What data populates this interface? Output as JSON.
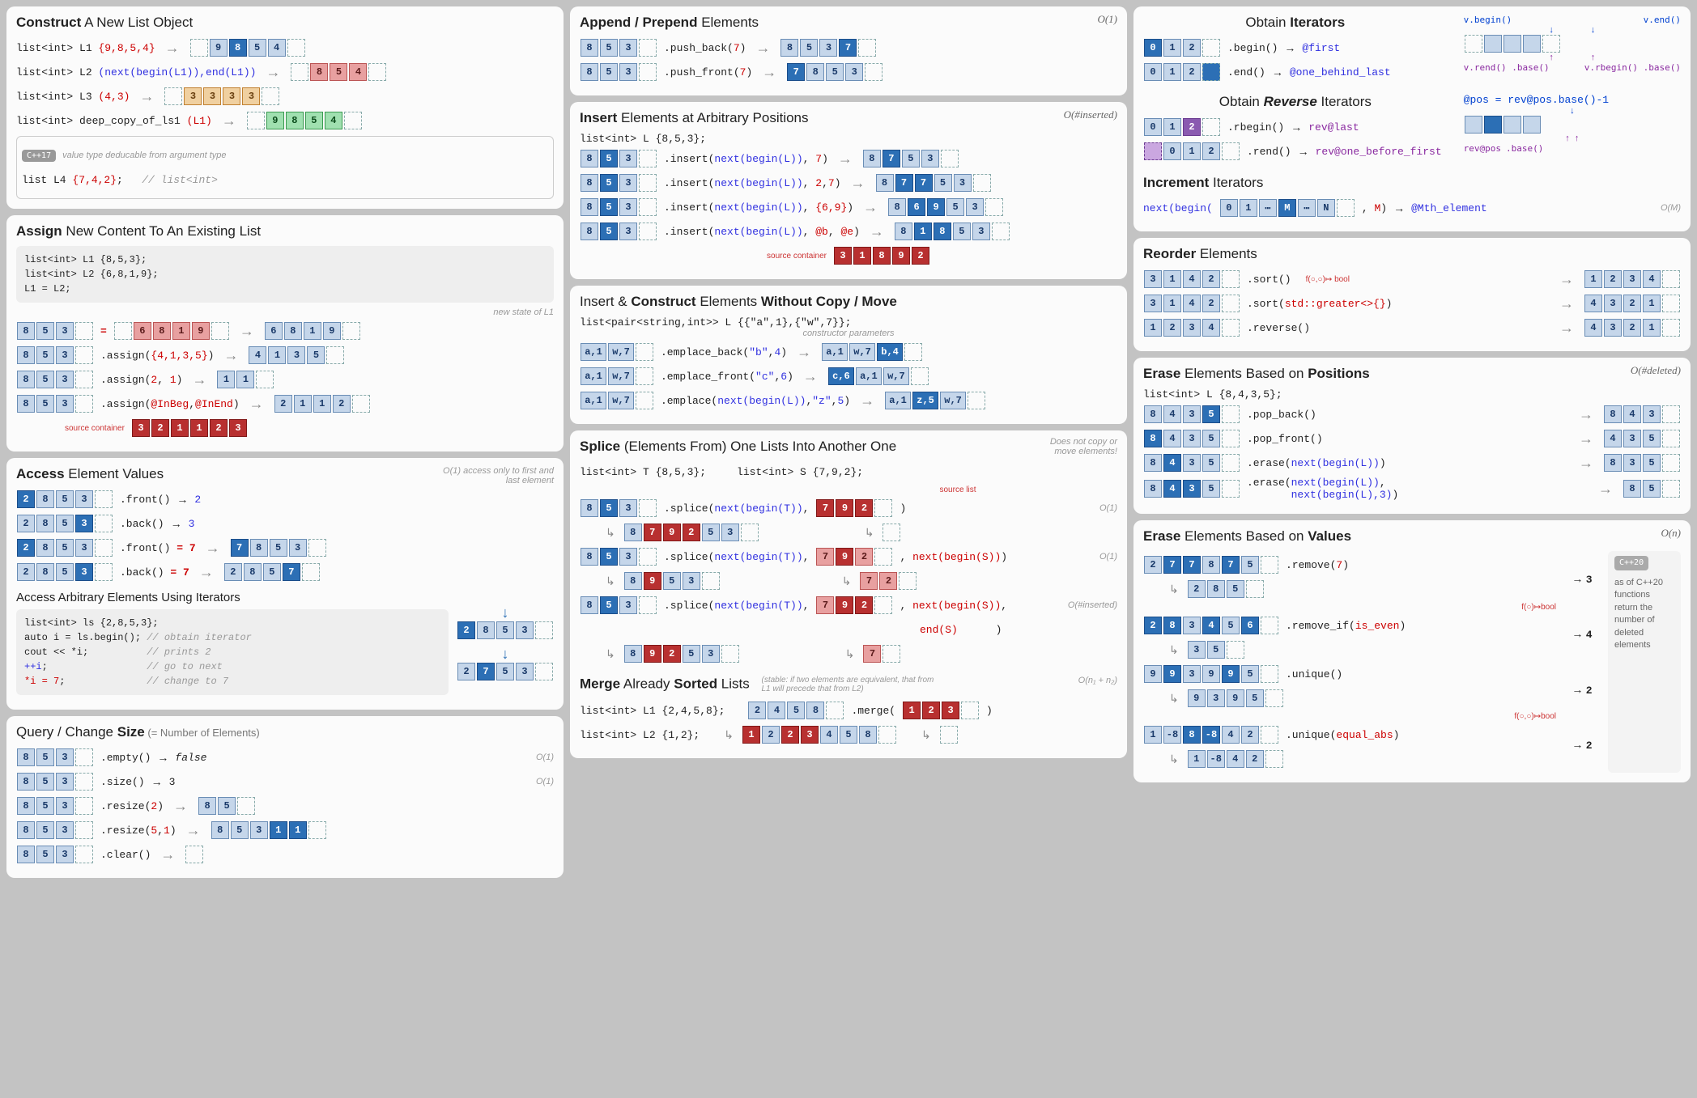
{
  "col1": {
    "construct": {
      "title_a": "Construct",
      "title_b": " A New List Object",
      "l1_decl": "list<int> L1 ",
      "l1_init": "{9,8,5,4}",
      "l1_cells": [
        "9",
        "8",
        "5",
        "4"
      ],
      "l2_decl": "list<int> L2 ",
      "l2_init": "(next(begin(L1)),end(L1))",
      "l2_cells": [
        "8",
        "5",
        "4"
      ],
      "l3_decl": "list<int> L3 ",
      "l3_init": "(4,3)",
      "l3_cells": [
        "3",
        "3",
        "3",
        "3"
      ],
      "l4_decl": "list<int> deep_copy_of_ls1 ",
      "l4_init": "(L1)",
      "l4_cells": [
        "9",
        "8",
        "5",
        "4"
      ],
      "tag": "C++17",
      "deduc_note": "value type deducable from argument type",
      "l5_decl": "list      L4 ",
      "l5_init": "{7,4,2}",
      "l5_cmt": "// list<int>"
    },
    "assign": {
      "title_a": "Assign",
      "title_b": " New Content To An Existing List",
      "code1": "list<int> L1 {8,5,3};",
      "code2": "list<int> L2 {6,8,1,9};",
      "code3": "L1         = L2;",
      "note": "new state of L1",
      "r1_before": [
        "8",
        "5",
        "3"
      ],
      "r1_op": "=",
      "r1_rhs": [
        "6",
        "8",
        "1",
        "9"
      ],
      "r1_after": [
        "6",
        "8",
        "1",
        "9"
      ],
      "r2_before": [
        "8",
        "5",
        "3"
      ],
      "r2_call": ".assign({4,1,3,5})",
      "r2_after": [
        "4",
        "1",
        "3",
        "5"
      ],
      "r3_before": [
        "8",
        "5",
        "3"
      ],
      "r3_call": ".assign(2, 1)",
      "r3_after": [
        "1",
        "1"
      ],
      "r4_before": [
        "8",
        "5",
        "3"
      ],
      "r4_call": ".assign(@InBeg,@InEnd)",
      "r4_after": [
        "2",
        "1",
        "1",
        "2"
      ],
      "r4_src_label": "source container",
      "r4_src": [
        "3",
        "2",
        "1",
        "1",
        "2",
        "3"
      ]
    },
    "access": {
      "title_a": "Access",
      "title_b": " Element Values",
      "note": "O(1) access only to first and last element",
      "r1_cells": [
        "2",
        "8",
        "5",
        "3"
      ],
      "r1_call": ".front()",
      "r1_res": "2",
      "r2_cells": [
        "2",
        "8",
        "5",
        "3"
      ],
      "r2_call": ".back()",
      "r2_res": "3",
      "r3_cells": [
        "2",
        "8",
        "5",
        "3"
      ],
      "r3_call": ".front() = 7",
      "r3_after": [
        "7",
        "8",
        "5",
        "3"
      ],
      "r4_cells": [
        "2",
        "8",
        "5",
        "3"
      ],
      "r4_call": ".back() = 7",
      "r4_after": [
        "2",
        "8",
        "5",
        "7"
      ],
      "sub_title": "Access Arbitrary Elements Using Iterators",
      "code1": "list<int> ls {2,8,5,3};",
      "code2": "auto i = ls.begin(); // obtain iterator",
      "code3": "cout << *i;          // prints 2",
      "code4": "++i;                 // go to next",
      "code5": "*i = 7;              // change to 7",
      "d1": [
        "2",
        "8",
        "5",
        "3"
      ],
      "d2": [
        "2",
        "7",
        "5",
        "3"
      ]
    },
    "size": {
      "title_a": "Query / Change ",
      "title_b": "Size",
      "title_c": " (= Number of Elements)",
      "r1_cells": [
        "8",
        "5",
        "3"
      ],
      "r1_call": ".empty()",
      "r1_res": "false",
      "r1_o": "O(1)",
      "r2_cells": [
        "8",
        "5",
        "3"
      ],
      "r2_call": ".size()",
      "r2_res": "3",
      "r2_o": "O(1)",
      "r3_cells": [
        "8",
        "5",
        "3"
      ],
      "r3_call": ".resize(2)",
      "r3_after": [
        "8",
        "5"
      ],
      "r4_cells": [
        "8",
        "5",
        "3"
      ],
      "r4_call": ".resize(5,1)",
      "r4_after": [
        "8",
        "5",
        "3",
        "1",
        "1"
      ],
      "r5_cells": [
        "8",
        "5",
        "3"
      ],
      "r5_call": ".clear()"
    }
  },
  "col2": {
    "append": {
      "title_a": "Append / Prepend",
      "title_b": " Elements",
      "bigO": "O(1)",
      "r1_before": [
        "8",
        "5",
        "3"
      ],
      "r1_call": ".push_back(7)",
      "r1_after": [
        "8",
        "5",
        "3",
        "7"
      ],
      "r2_before": [
        "8",
        "5",
        "3"
      ],
      "r2_call": ".push_front(7)",
      "r2_after": [
        "7",
        "8",
        "5",
        "3"
      ]
    },
    "insert": {
      "title_a": "Insert",
      "title_b": " Elements at Arbitrary Positions",
      "bigO": "O(#inserted)",
      "decl": "list<int> L {8,5,3};",
      "r1_before": [
        "8",
        "5",
        "3"
      ],
      "r1_call": ".insert(next(begin(L)), 7)",
      "r1_after": [
        "8",
        "7",
        "5",
        "3"
      ],
      "r2_before": [
        "8",
        "5",
        "3"
      ],
      "r2_call": ".insert(next(begin(L)), 2,7)",
      "r2_after": [
        "8",
        "7",
        "7",
        "5",
        "3"
      ],
      "r3_before": [
        "8",
        "5",
        "3"
      ],
      "r3_call": ".insert(next(begin(L)), {6,9})",
      "r3_after": [
        "8",
        "6",
        "9",
        "5",
        "3"
      ],
      "r4_before": [
        "8",
        "5",
        "3"
      ],
      "r4_call": ".insert(next(begin(L)), @b, @e)",
      "r4_after": [
        "8",
        "1",
        "8",
        "5",
        "3"
      ],
      "r4_src_label": "source container",
      "r4_src": [
        "3",
        "1",
        "8",
        "9",
        "2"
      ]
    },
    "emplace": {
      "title_a": "Insert & ",
      "title_b": "Construct",
      "title_c": " Elements ",
      "title_d": "Without Copy / Move",
      "decl": "list<pair<string,int>> L {{\"a\",1},{\"w\",7}};",
      "note": "constructor parameters",
      "r1_before": [
        "a,1",
        "w,7"
      ],
      "r1_call": ".emplace_back(\"b\",4)",
      "r1_after": [
        "a,1",
        "w,7",
        "b,4"
      ],
      "r2_before": [
        "a,1",
        "w,7"
      ],
      "r2_call": ".emplace_front(\"c\",6)",
      "r2_after": [
        "c,6",
        "a,1",
        "w,7"
      ],
      "r3_before": [
        "a,1",
        "w,7"
      ],
      "r3_call": ".emplace(next(begin(L)),\"z\",5)",
      "r3_after": [
        "a,1",
        "z,5",
        "w,7"
      ]
    },
    "splice": {
      "title_a": "Splice",
      "title_b": " (Elements From) One Lists Into Another One",
      "note": "Does not copy or move elements!",
      "declT": "list<int> T {8,5,3};",
      "declS": "list<int> S {7,9,2};",
      "src_label": "source list",
      "r1_bT": [
        "8",
        "5",
        "3"
      ],
      "r1_call": ".splice(next(begin(T)), ",
      "r1_S": [
        "7",
        "9",
        "2"
      ],
      "r1_end": ")",
      "r1_aT": [
        "8",
        "7",
        "9",
        "2",
        "5",
        "3"
      ],
      "r1_aS": [],
      "r1_o": "O(1)",
      "r2_bT": [
        "8",
        "5",
        "3"
      ],
      "r2_call": ".splice(next(begin(T)), ",
      "r2_S": [
        "7",
        "9",
        "2"
      ],
      "r2_tail": ", next(begin(S)))",
      "r2_aT": [
        "8",
        "9",
        "5",
        "3"
      ],
      "r2_aS": [
        "7",
        "2"
      ],
      "r2_o": "O(1)",
      "r3_bT": [
        "8",
        "5",
        "3"
      ],
      "r3_call": ".splice(next(begin(T)), ",
      "r3_S": [
        "7",
        "9",
        "2"
      ],
      "r3_tail1": ", next(begin(S)),",
      "r3_tail2": "         end(S)      )",
      "r3_aT": [
        "8",
        "9",
        "2",
        "5",
        "3"
      ],
      "r3_aS": [
        "7"
      ],
      "r3_o": "O(#inserted)",
      "merge_title_a": "Merge",
      "merge_title_b": " Already ",
      "merge_title_c": "Sorted",
      "merge_title_d": " Lists",
      "merge_note": "(stable: if two elements are equivalent, that from L1 will precede that from L2)",
      "merge_o": "O(n₁ + n₂)",
      "declL1": "list<int> L1 {2,4,5,8};",
      "declL2": "list<int> L2 {1,2};",
      "m_l1": [
        "2",
        "4",
        "5",
        "8"
      ],
      "m_call": ".merge(",
      "m_l2": [
        "1",
        "2",
        "3"
      ],
      "m_end": ")",
      "m_a1": [
        "1",
        "2",
        "2",
        "3",
        "4",
        "5",
        "8"
      ]
    }
  },
  "col3": {
    "iter": {
      "title_a": "Obtain ",
      "title_b": "Iterators",
      "r1_cells": [
        "0",
        "1",
        "2"
      ],
      "r1_call": ".begin()",
      "r1_res": "@first",
      "r2_cells": [
        "0",
        "1",
        "2"
      ],
      "r2_call": ".end()",
      "r2_res": "@one_behind_last",
      "vb": "v.begin()",
      "ve": "v.end()",
      "vrend": "v.rend() .base()",
      "vrbeg": "v.rbegin() .base()",
      "rev_title_a": "Obtain ",
      "rev_title_b": "Reverse",
      "rev_title_c": " Iterators",
      "r3_cells": [
        "0",
        "1",
        "2"
      ],
      "r3_call": ".rbegin()",
      "r3_res": "rev@last",
      "r4_cells": [
        "0",
        "1",
        "2"
      ],
      "r4_call": ".rend()",
      "r4_res": "rev@one_before_first",
      "pos_label": "@pos = rev@pos.base()-1",
      "revpos": "rev@pos",
      "base": ".base()",
      "inc_title_a": "Increment",
      "inc_title_b": " Iterators",
      "inc_call_a": "next(begin(",
      "inc_cells": [
        "0",
        "1",
        "⋯",
        "M",
        "⋯",
        "N"
      ],
      "inc_call_b": ", M)",
      "inc_res": "@Mth_element",
      "inc_o": "O(M)"
    },
    "reorder": {
      "title_a": "Reorder",
      "title_b": " Elements",
      "r1_before": [
        "3",
        "1",
        "4",
        "2"
      ],
      "r1_call": ".sort()",
      "r1_note": "f(○,○)↦ bool",
      "r1_after": [
        "1",
        "2",
        "3",
        "4"
      ],
      "r2_before": [
        "3",
        "1",
        "4",
        "2"
      ],
      "r2_call": ".sort(std::greater<>{})",
      "r2_after": [
        "4",
        "3",
        "2",
        "1"
      ],
      "r3_before": [
        "1",
        "2",
        "3",
        "4"
      ],
      "r3_call": ".reverse()",
      "r3_after": [
        "4",
        "3",
        "2",
        "1"
      ]
    },
    "erasepos": {
      "title_a": "Erase",
      "title_b": " Elements Based on ",
      "title_c": "Positions",
      "bigO": "O(#deleted)",
      "decl": "list<int> L {8,4,3,5};",
      "r1_before": [
        "8",
        "4",
        "3",
        "5"
      ],
      "r1_call": ".pop_back()",
      "r1_after": [
        "8",
        "4",
        "3"
      ],
      "r2_before": [
        "8",
        "4",
        "3",
        "5"
      ],
      "r2_call": ".pop_front()",
      "r2_after": [
        "4",
        "3",
        "5"
      ],
      "r3_before": [
        "8",
        "4",
        "3",
        "5"
      ],
      "r3_call": ".erase(next(begin(L)))",
      "r3_after": [
        "8",
        "3",
        "5"
      ],
      "r4_before": [
        "8",
        "4",
        "3",
        "5"
      ],
      "r4_call_a": ".erase(next(begin(L)),",
      "r4_call_b": "       next(begin(L),3))",
      "r4_after": [
        "8",
        "5"
      ]
    },
    "eraseval": {
      "title_a": "Erase",
      "title_b": " Elements Based on ",
      "title_c": "Values",
      "bigO": "O(n)",
      "r1_before": [
        "2",
        "7",
        "7",
        "8",
        "7",
        "5"
      ],
      "r1_call": ".remove(7)",
      "r1_ret": "3",
      "r1_after": [
        "2",
        "8",
        "5"
      ],
      "r2_before": [
        "2",
        "8",
        "3",
        "4",
        "5",
        "6"
      ],
      "r2_call": ".remove_if(is_even)",
      "r2_note": "f(○)↦bool",
      "r2_ret": "4",
      "r2_after": [
        "3",
        "5"
      ],
      "r3_before": [
        "9",
        "9",
        "3",
        "9",
        "9",
        "5"
      ],
      "r3_call": ".unique()",
      "r3_ret": "2",
      "r3_after": [
        "9",
        "3",
        "9",
        "5"
      ],
      "r4_before": [
        "1",
        "-8",
        "8",
        "-8",
        "4",
        "2"
      ],
      "r4_call": ".unique(equal_abs)",
      "r4_note": "f(○,○)↦bool",
      "r4_ret": "2",
      "r4_after": [
        "1",
        "-8",
        "4",
        "2"
      ],
      "tag": "C++20",
      "boxnote": "as of C++20 functions return the number of deleted elements"
    }
  }
}
